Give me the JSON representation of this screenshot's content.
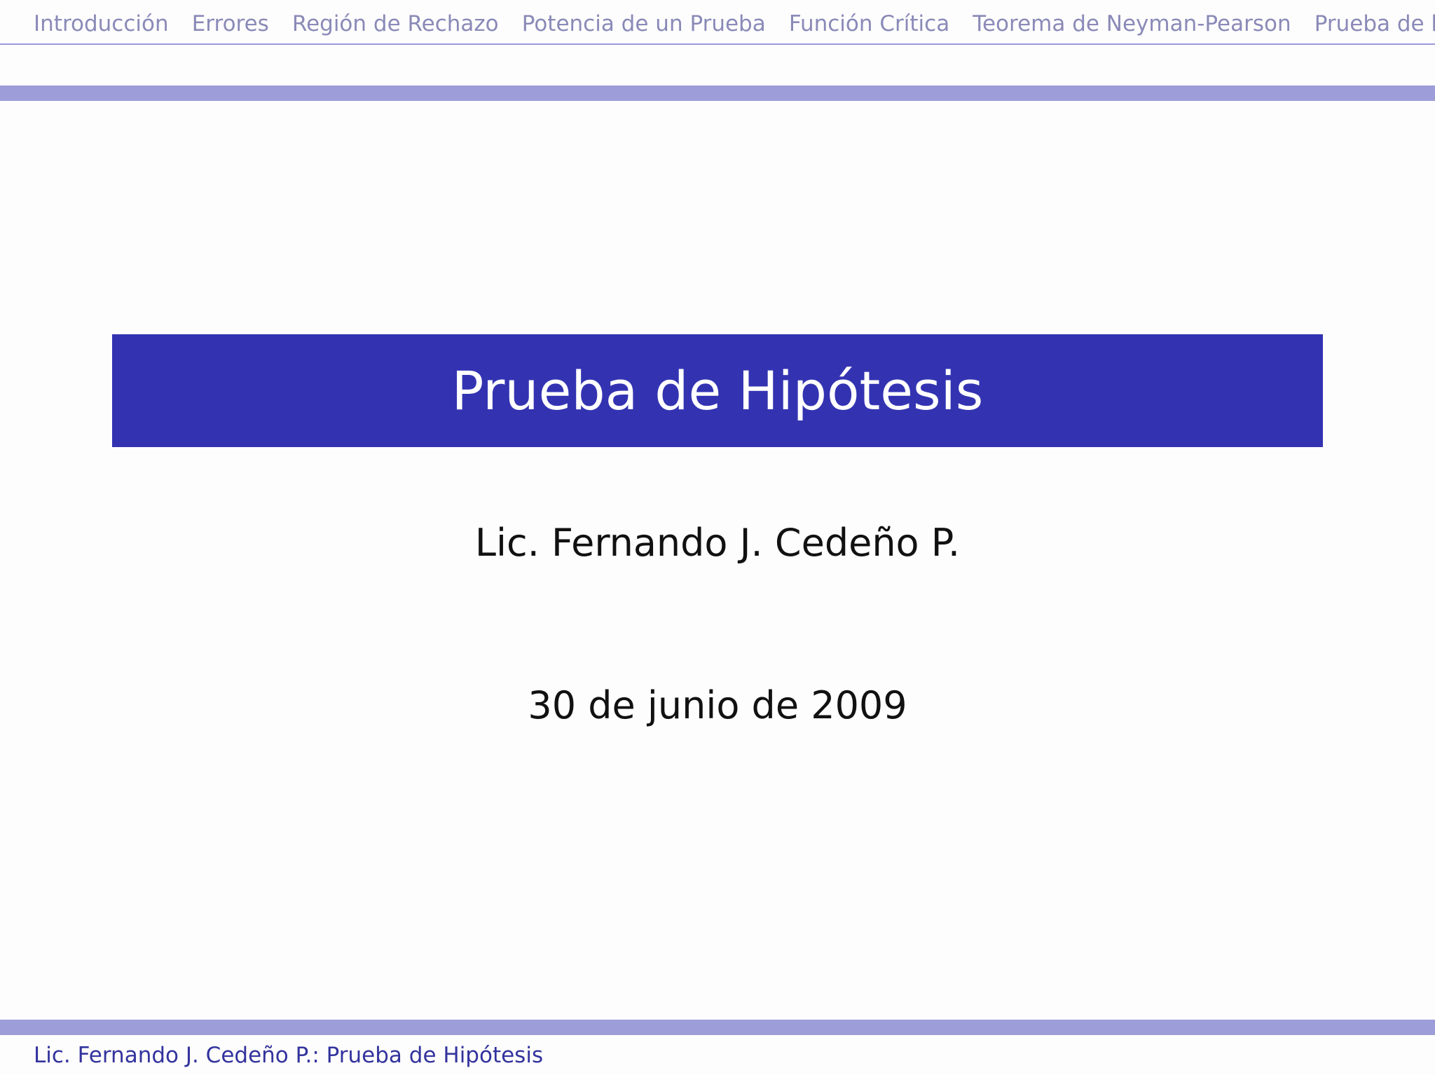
{
  "nav": {
    "items": [
      "Introducción",
      "Errores",
      "Región de Rechazo",
      "Potencia de un Prueba",
      "Función Crítica",
      "Teorema de Neyman-Pearson",
      "Prueba de hipóte"
    ]
  },
  "title": "Prueba de Hipótesis",
  "author": "Lic. Fernando J. Cedeño P.",
  "date": "30 de junio de 2009",
  "footer": "Lic. Fernando J. Cedeño P.: Prueba de Hipótesis",
  "colors": {
    "accent": "#3333b2",
    "rule": "#9d9dda",
    "nav_text": "#8a8ab8"
  }
}
